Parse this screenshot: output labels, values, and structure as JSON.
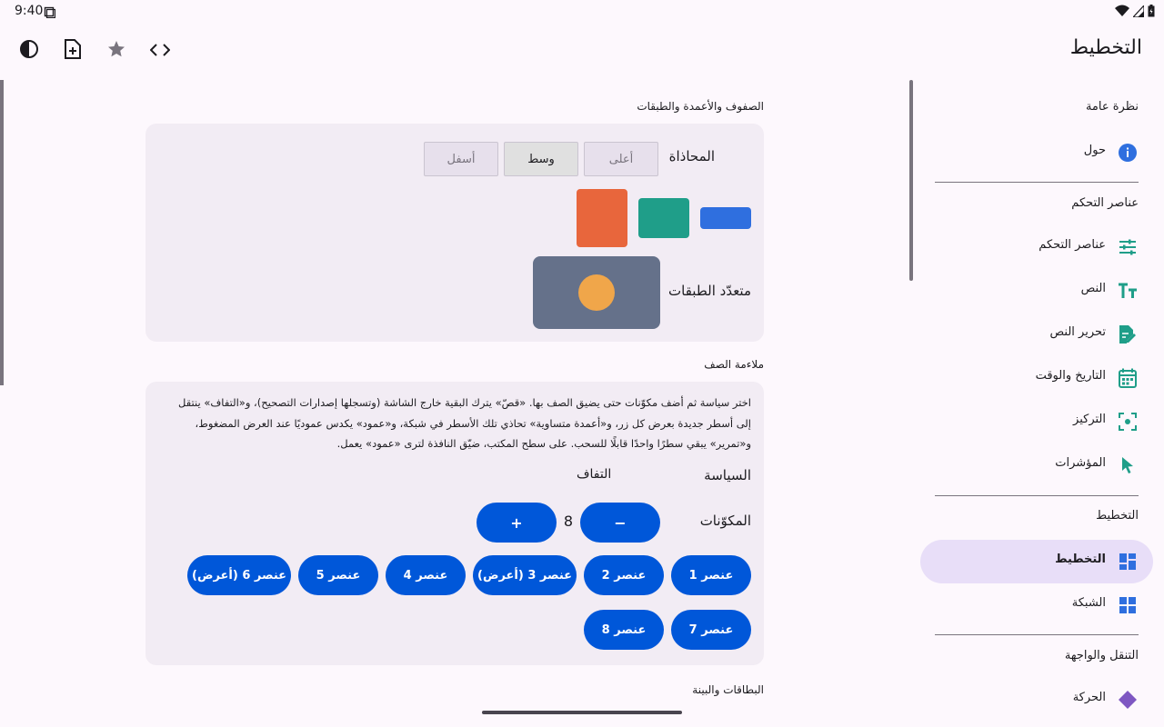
{
  "status": {
    "time": "9:40"
  },
  "appbar": {
    "title": "التخطيط"
  },
  "nav": {
    "sections": [
      "نظرة عامة",
      "عناصر التحكم",
      "التخطيط",
      "التنقل والواجهة"
    ],
    "items": [
      {
        "label": "حول",
        "icon": "info-icon"
      },
      {
        "label": "عناصر التحكم",
        "icon": "sliders-icon"
      },
      {
        "label": "النص",
        "icon": "text-icon"
      },
      {
        "label": "تحرير النص",
        "icon": "edit-document-icon"
      },
      {
        "label": "التاريخ والوقت",
        "icon": "calendar-icon"
      },
      {
        "label": "التركيز",
        "icon": "focus-icon"
      },
      {
        "label": "المؤشرات",
        "icon": "pointer-icon"
      },
      {
        "label": "التخطيط",
        "icon": "dashboard-icon"
      },
      {
        "label": "الشبكة",
        "icon": "grid-icon"
      }
    ],
    "partial_label": "الحركة"
  },
  "rows": {
    "heading": "الصفوف والأعمدة والطبقات",
    "alignment_label": "المحاذاة",
    "alignment_options": [
      "أعلى",
      "وسط",
      "أسفل"
    ],
    "alignment_selected": "وسط",
    "layers_label": "متعدّد الطبقات"
  },
  "fit": {
    "heading": "ملاءمة الصف",
    "description": "اختر سياسة ثم أضف مكوّنات حتى يضيق الصف بها. «قصّ» يترك البقية خارج الشاشة (وتسجلها إصدارات التصحيح)، و«التفاف» ينتقل إلى أسطر جديدة بعرض كل زر، و«أعمدة متساوية» تحاذي تلك الأسطر في شبكة، و«عمود» يكدس عموديًا عند العرض المضغوط، و«تمرير» يبقي سطرًا واحدًا قابلًا للسحب. على سطح المكتب، ضيّق النافذة لترى «عمود» يعمل.",
    "policy_label": "السياسة",
    "policy_value": "التفاف",
    "components_label": "المكوّنات",
    "count": "8",
    "minus": "−",
    "plus": "+",
    "items": [
      "عنصر 1",
      "عنصر 2",
      "عنصر 3 (أعرض)",
      "عنصر 4",
      "عنصر 5",
      "عنصر 6 (أعرض)",
      "عنصر 7",
      "عنصر 8"
    ]
  },
  "cards": {
    "heading": "البطاقات والبينة"
  },
  "colors": {
    "blue": "#2f6fdf",
    "teal": "#1f9e89",
    "orange": "#e8663c",
    "slate": "#65718a",
    "amber": "#f0a64a",
    "pill": "#0057d9",
    "nav_active": "#e8def8"
  }
}
